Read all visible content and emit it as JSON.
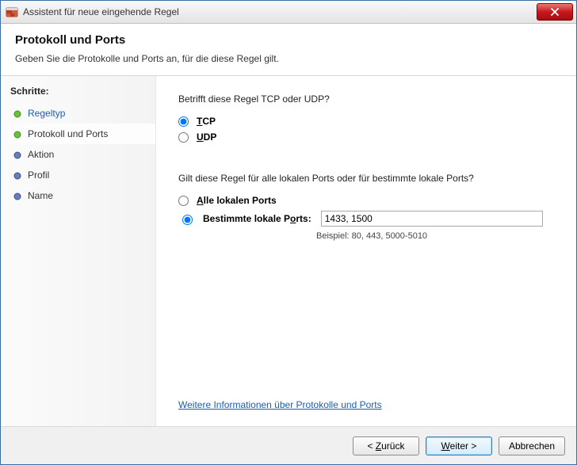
{
  "title": "Assistent für neue eingehende Regel",
  "header": {
    "heading": "Protokoll und Ports",
    "subheading": "Geben Sie die Protokolle und Ports an, für die diese Regel gilt."
  },
  "sidebar": {
    "steps_label": "Schritte:",
    "steps": [
      {
        "label": "Regeltyp",
        "state": "completed"
      },
      {
        "label": "Protokoll und Ports",
        "state": "current"
      },
      {
        "label": "Aktion",
        "state": "upcoming"
      },
      {
        "label": "Profil",
        "state": "upcoming"
      },
      {
        "label": "Name",
        "state": "upcoming"
      }
    ]
  },
  "main": {
    "question_protocol": "Betrifft diese Regel TCP oder UDP?",
    "tcp_first": "T",
    "tcp_rest": "CP",
    "udp_first": "U",
    "udp_rest": "DP",
    "protocol_selected": "tcp",
    "question_ports": "Gilt diese Regel für alle lokalen Ports oder für bestimmte lokale Ports?",
    "all_ports_first": "A",
    "all_ports_rest": "lle lokalen Ports",
    "specific_ports_prefix": "Bestimmte lokale P",
    "specific_ports_accel": "o",
    "specific_ports_suffix": "rts:",
    "ports_selected": "specific",
    "ports_value": "1433, 1500",
    "ports_example": "Beispiel: 80, 443, 5000-5010",
    "more_info_link": "Weitere Informationen über Protokolle und Ports"
  },
  "footer": {
    "back_lt": "< ",
    "back_accel": "Z",
    "back_rest": "urück",
    "next_accel": "W",
    "next_rest": "eiter >",
    "cancel": "Abbrechen"
  }
}
